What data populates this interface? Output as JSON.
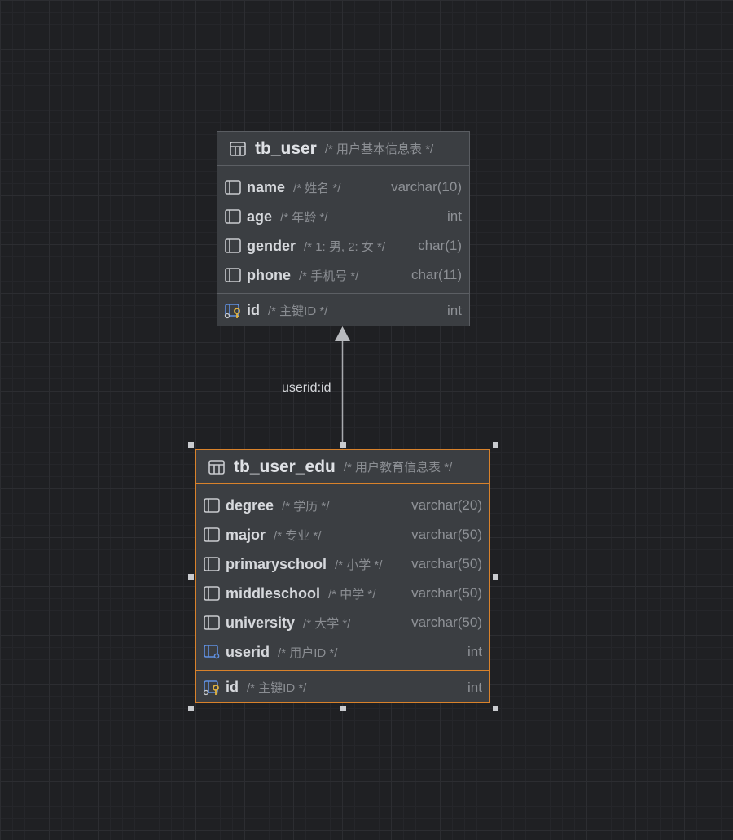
{
  "tables": [
    {
      "name": "tb_user",
      "comment": "/* 用户基本信息表 */",
      "columns": [
        {
          "name": "name",
          "comment": "/* 姓名 */",
          "type": "varchar(10)",
          "icon": "column-icon"
        },
        {
          "name": "age",
          "comment": "/* 年龄 */",
          "type": "int",
          "icon": "column-icon"
        },
        {
          "name": "gender",
          "comment": "/* 1: 男, 2: 女 */",
          "type": "char(1)",
          "icon": "column-icon"
        },
        {
          "name": "phone",
          "comment": "/* 手机号 */",
          "type": "char(11)",
          "icon": "column-icon"
        }
      ],
      "primary_key": {
        "name": "id",
        "comment": "/* 主键ID */",
        "type": "int",
        "icon": "primary-key-icon"
      }
    },
    {
      "name": "tb_user_edu",
      "comment": "/* 用户教育信息表 */",
      "selected": true,
      "columns": [
        {
          "name": "degree",
          "comment": "/* 学历 */",
          "type": "varchar(20)",
          "icon": "column-icon"
        },
        {
          "name": "major",
          "comment": "/* 专业 */",
          "type": "varchar(50)",
          "icon": "column-icon"
        },
        {
          "name": "primaryschool",
          "comment": "/* 小学 */",
          "type": "varchar(50)",
          "icon": "column-icon"
        },
        {
          "name": "middleschool",
          "comment": "/* 中学 */",
          "type": "varchar(50)",
          "icon": "column-icon"
        },
        {
          "name": "university",
          "comment": "/* 大学 */",
          "type": "varchar(50)",
          "icon": "column-icon"
        },
        {
          "name": "userid",
          "comment": "/* 用户ID */",
          "type": "int",
          "icon": "foreign-key-icon"
        }
      ],
      "primary_key": {
        "name": "id",
        "comment": "/* 主键ID */",
        "type": "int",
        "icon": "primary-key-icon"
      }
    }
  ],
  "relationship": {
    "label": "userid:id",
    "from": "tb_user_edu",
    "to": "tb_user"
  },
  "colors": {
    "background": "#1f2023",
    "table_fill": "#3b3e42",
    "selection": "#d9822b",
    "key_icon": "#e0b341",
    "fk_icon": "#5f8fe0"
  }
}
